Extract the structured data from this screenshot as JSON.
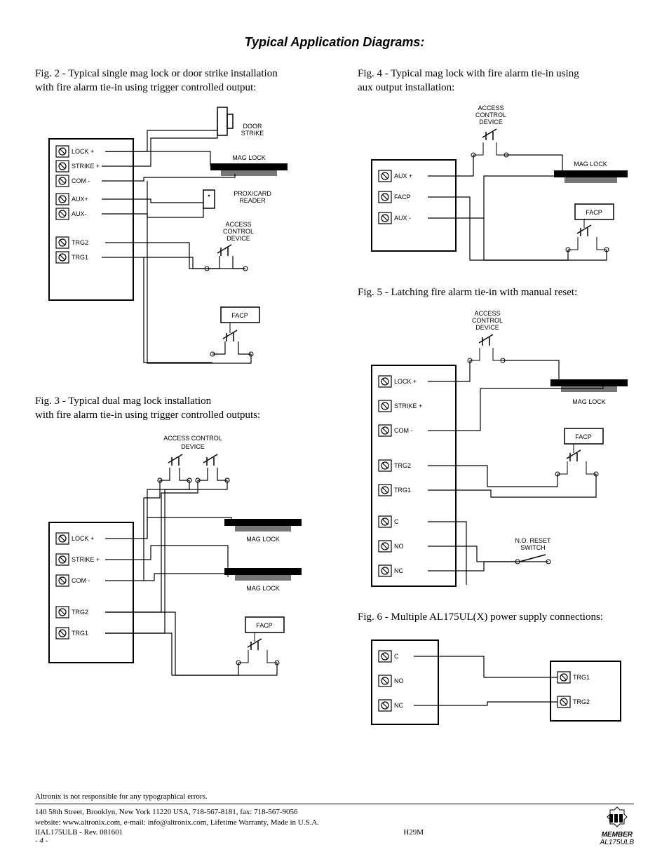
{
  "title": "Typical Application Diagrams:",
  "fig2": {
    "caption_line1": "Fig. 2 -  Typical single mag lock or door strike installation",
    "caption_line2": "with fire alarm tie-in using trigger controlled output:",
    "terms": [
      "LOCK +",
      "STRIKE +",
      "COM -",
      "AUX+",
      "AUX-",
      "TRG2",
      "TRG1"
    ],
    "labels": {
      "doorstrike1": "DOOR",
      "doorstrike2": "STRIKE",
      "maglock": "MAG LOCK",
      "prox1": "PROX/CARD",
      "prox2": "READER",
      "acd1": "ACCESS",
      "acd2": "CONTROL",
      "acd3": "DEVICE",
      "facp": "FACP"
    }
  },
  "fig3": {
    "caption_line1": "Fig. 3 - Typical dual mag lock installation",
    "caption_line2": "with fire alarm tie-in using trigger controlled outputs:",
    "terms": [
      "LOCK +",
      "STRIKE +",
      "COM -",
      "TRG2",
      "TRG1"
    ],
    "labels": {
      "acd1": "ACCESS CONTROL",
      "acd2": "DEVICE",
      "maglock": "MAG LOCK",
      "facp": "FACP"
    }
  },
  "fig4": {
    "caption_line1": "Fig. 4 -  Typical mag lock with fire alarm tie-in using",
    "caption_line2": "aux output installation:",
    "terms": [
      "AUX +",
      "FACP",
      "AUX -"
    ],
    "labels": {
      "acd1": "ACCESS",
      "acd2": "CONTROL",
      "acd3": "DEVICE",
      "maglock": "MAG LOCK",
      "facp": "FACP"
    }
  },
  "fig5": {
    "caption": "Fig. 5 - Latching fire alarm tie-in with manual reset:",
    "terms": [
      "LOCK +",
      "STRIKE +",
      "COM -",
      "TRG2",
      "TRG1",
      "C",
      "NO",
      "NC"
    ],
    "labels": {
      "acd1": "ACCESS",
      "acd2": "CONTROL",
      "acd3": "DEVICE",
      "maglock": "MAG LOCK",
      "facp": "FACP",
      "reset1": "N.O. RESET",
      "reset2": "SWITCH"
    }
  },
  "fig6": {
    "caption": "Fig. 6 - Multiple AL175UL(X) power supply connections:",
    "terms_left": [
      "C",
      "NO",
      "NC"
    ],
    "terms_right": [
      "TRG1",
      "TRG2"
    ]
  },
  "footer": {
    "disclaimer": "Altronix is not responsible for any typographical errors.",
    "addr": "140 58th Street, Brooklyn, New York 11220 USA, 718-567-8181, fax: 718-567-9056",
    "web": "website: www.altronix.com, e-mail: info@altronix.com, Lifetime Warranty, Made in U.S.A.",
    "rev": "IIAL175ULB - Rev. 081601",
    "code": "H29M",
    "page": "- 4 -",
    "member": "MEMBER",
    "model": "AL175ULB"
  }
}
